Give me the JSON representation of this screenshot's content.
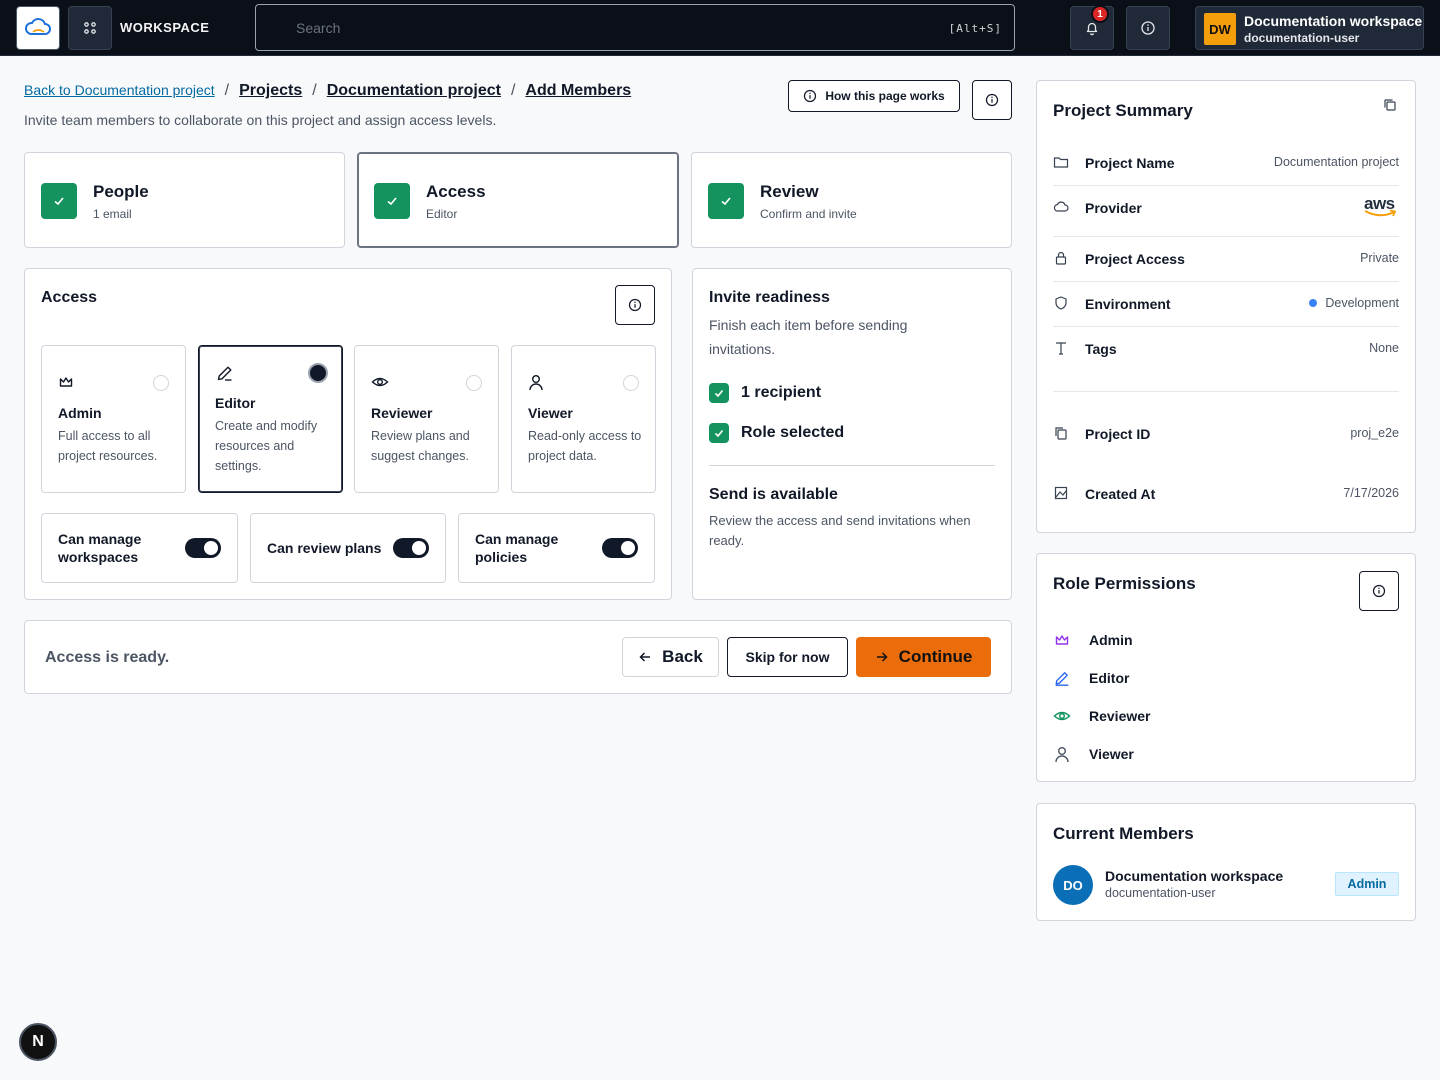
{
  "header": {
    "workspace_label": "WORKSPACE",
    "search_placeholder": "Search",
    "search_shortcut": "[Alt+S]",
    "notification_count": "1",
    "user_initials": "DW",
    "user_name": "Documentation workspace",
    "user_handle": "documentation-user"
  },
  "breadcrumb": {
    "back": "Back to Documentation project",
    "items": [
      "Projects",
      "Documentation project",
      "Add Members"
    ],
    "separator": "/"
  },
  "page": {
    "subtitle": "Invite team members to collaborate on this project and assign access levels.",
    "how_button": "How this page works"
  },
  "steps": [
    {
      "title": "People",
      "subtitle": "1 email"
    },
    {
      "title": "Access",
      "subtitle": "Editor"
    },
    {
      "title": "Review",
      "subtitle": "Confirm and invite"
    }
  ],
  "access": {
    "title": "Access",
    "roles": [
      {
        "name": "Admin",
        "desc": "Full access to all project resources.",
        "icon": "crown-icon",
        "selected": false
      },
      {
        "name": "Editor",
        "desc": "Create and modify resources and settings.",
        "icon": "pencil-icon",
        "selected": true
      },
      {
        "name": "Reviewer",
        "desc": "Review plans and suggest changes.",
        "icon": "eye-icon",
        "selected": false
      },
      {
        "name": "Viewer",
        "desc": "Read-only access to project data.",
        "icon": "user-icon",
        "selected": false
      }
    ],
    "permissions": [
      {
        "label": "Can manage workspaces",
        "enabled": true
      },
      {
        "label": "Can review plans",
        "enabled": true
      },
      {
        "label": "Can manage policies",
        "enabled": true
      }
    ]
  },
  "readiness": {
    "title": "Invite readiness",
    "desc": "Finish each item before sending invitations.",
    "items": [
      "1 recipient",
      "Role selected"
    ],
    "send_title": "Send is available",
    "send_desc": "Review the access and send invitations when ready."
  },
  "footer": {
    "status": "Access is ready.",
    "back": "Back",
    "skip": "Skip for now",
    "continue": "Continue"
  },
  "summary": {
    "title": "Project Summary",
    "rows": [
      {
        "key": "Project Name",
        "value": "Documentation project",
        "icon": "folder-icon"
      },
      {
        "key": "Provider",
        "value": "aws",
        "icon": "cloud-icon"
      },
      {
        "key": "Project Access",
        "value": "Private",
        "icon": "lock-icon"
      },
      {
        "key": "Environment",
        "value": "Development",
        "icon": "shield-icon"
      },
      {
        "key": "Tags",
        "value": "None",
        "icon": "text-icon"
      },
      {
        "key": "Project ID",
        "value": "proj_e2e",
        "icon": "copy-icon"
      },
      {
        "key": "Created At",
        "value": "7/17/2026",
        "icon": "image-icon"
      }
    ]
  },
  "role_permissions": {
    "title": "Role Permissions",
    "roles": [
      "Admin",
      "Editor",
      "Reviewer",
      "Viewer"
    ]
  },
  "members": {
    "title": "Current Members",
    "items": [
      {
        "initials": "DO",
        "name": "Documentation workspace",
        "handle": "documentation-user",
        "role": "Admin"
      }
    ]
  },
  "dev_badge": "N",
  "colors": {
    "accent": "#ea6c0a",
    "success": "#15935f",
    "link": "#0369a1",
    "environment_dot": "#3b82f6",
    "member_avatar": "#0b6fb8"
  }
}
